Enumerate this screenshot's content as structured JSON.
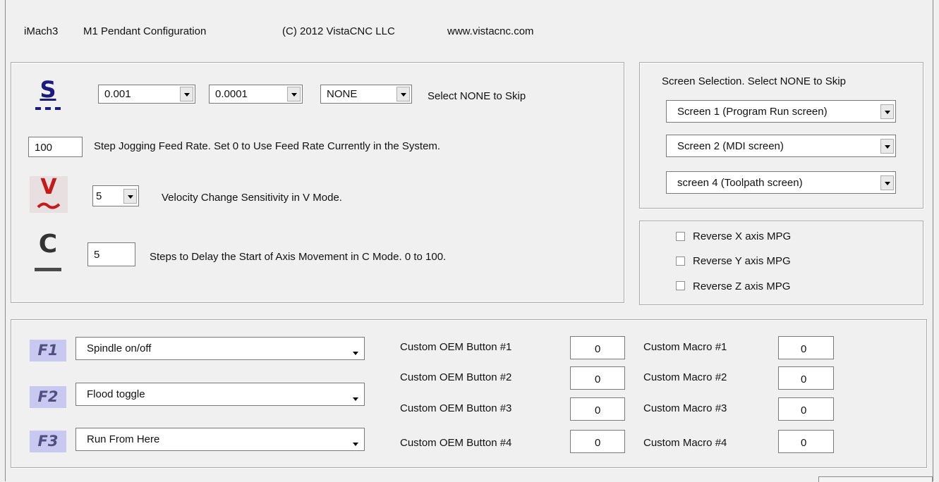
{
  "header": {
    "app": "iMach3",
    "title": "M1 Pendant Configuration",
    "copyright": "(C) 2012 VistaCNC LLC",
    "website": "www.vistacnc.com"
  },
  "step": {
    "combo1": "0.001",
    "combo2": "0.0001",
    "combo3": "NONE",
    "skip_text": "Select NONE to Skip",
    "feed_value": "100",
    "feed_text": "Step Jogging Feed Rate. Set 0 to Use Feed Rate Currently in the System."
  },
  "velocity": {
    "value": "5",
    "text": "Velocity Change Sensitivity in V Mode."
  },
  "cmode": {
    "value": "5",
    "text": "Steps to Delay the Start of Axis Movement in C Mode.  0 to 100."
  },
  "icons": {
    "s": "S",
    "v": "V",
    "c": "C"
  },
  "screen_selection": {
    "title": "Screen Selection. Select NONE to Skip",
    "options": [
      "Screen 1 (Program Run screen)",
      "Screen 2 (MDI screen)",
      "screen 4 (Toolpath screen)"
    ]
  },
  "reverse": {
    "x": "Reverse X axis MPG",
    "y": "Reverse Y axis MPG",
    "z": "Reverse Z axis MPG"
  },
  "fkeys": [
    {
      "key": "F1",
      "action": "Spindle on/off"
    },
    {
      "key": "F2",
      "action": "Flood toggle"
    },
    {
      "key": "F3",
      "action": "Run From Here"
    }
  ],
  "oem": [
    {
      "label": "Custom OEM Button #1",
      "value": "0"
    },
    {
      "label": "Custom OEM Button #2",
      "value": "0"
    },
    {
      "label": "Custom OEM Button #3",
      "value": "0"
    },
    {
      "label": "Custom OEM Button #4",
      "value": "0"
    }
  ],
  "macro": [
    {
      "label": "Custom Macro #1",
      "value": "0"
    },
    {
      "label": "Custom Macro #2",
      "value": "0"
    },
    {
      "label": "Custom Macro #3",
      "value": "0"
    },
    {
      "label": "Custom Macro #4",
      "value": "0"
    }
  ],
  "colors": {
    "s_icon": "#1a1a80",
    "v_icon": "#c41a1a",
    "c_icon": "#222222",
    "f_badge_bg": "#c8c8f0",
    "f_badge_text": "#4f4f80"
  }
}
